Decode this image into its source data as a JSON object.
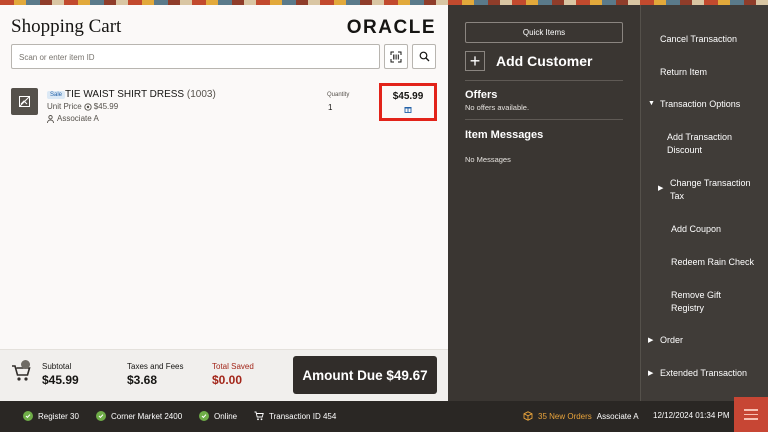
{
  "header": {
    "title": "Shopping Cart",
    "logo_text": "ORACLE"
  },
  "search": {
    "placeholder": "Scan or enter item ID",
    "barcode_icon": "barcode-scan-icon",
    "search_icon": "search-icon"
  },
  "cart": {
    "items": [
      {
        "badge": "Sale",
        "name": "TIE WAIST SHIRT DRESS",
        "sku": "(1003)",
        "unit_price_label": "Unit Price",
        "unit_price": "$45.99",
        "associate": "Associate A",
        "quantity_label": "Quantity",
        "quantity": "1",
        "price": "$45.99"
      }
    ]
  },
  "totals": {
    "subtotal_label": "Subtotal",
    "subtotal": "$45.99",
    "taxes_label": "Taxes and Fees",
    "taxes": "$3.68",
    "saved_label": "Total Saved",
    "saved": "$0.00",
    "amount_due": "Amount Due $49.67"
  },
  "middle_panel": {
    "quick_items": "Quick Items",
    "add_customer": "Add Customer",
    "offers_title": "Offers",
    "offers_sub": "No offers available.",
    "messages_title": "Item Messages",
    "messages_sub": "No Messages"
  },
  "actions": {
    "cancel": "Cancel Transaction",
    "return_item": "Return Item",
    "options": "Transaction Options",
    "add_discount_1": "Add Transaction",
    "add_discount_2": "Discount",
    "change_tax_1": "Change Transaction",
    "change_tax_2": "Tax",
    "add_coupon": "Add Coupon",
    "rain_check": "Redeem Rain Check",
    "gift_registry_1": "Remove Gift",
    "gift_registry_2": "Registry",
    "order": "Order",
    "extended": "Extended Transaction"
  },
  "status_bar": {
    "register": "Register 30",
    "store": "Corner Market 2400",
    "online": "Online",
    "transaction": "Transaction ID 454",
    "new_orders": "35 New Orders",
    "associate": "Associate A",
    "datetime": "12/12/2024 01:34 PM"
  },
  "colors": {
    "accent_red": "#e2231a",
    "saved_red": "#a3261a",
    "dark_panel": "#3a3632",
    "online_green": "#6fad48",
    "orders_orange": "#e8a33b",
    "menu_red": "#c74634"
  }
}
